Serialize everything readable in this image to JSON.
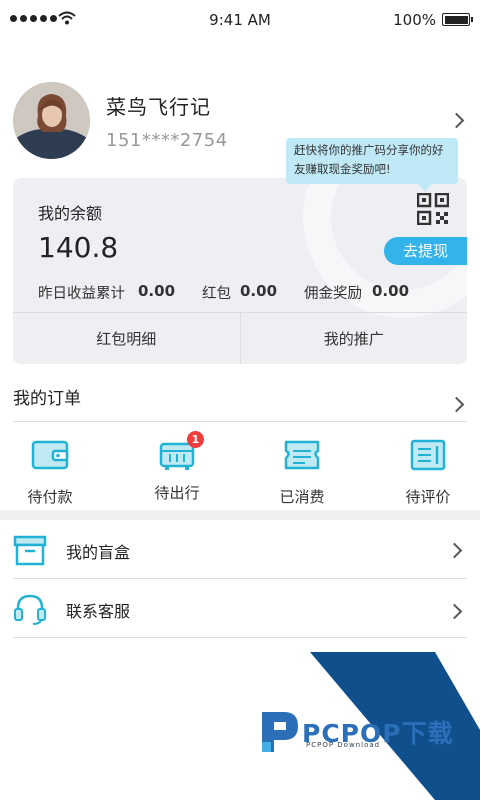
{
  "status_bar": {
    "time": "9:41 AM",
    "battery": "100%"
  },
  "profile": {
    "name": "菜鸟飞行记",
    "phone": "151****2754"
  },
  "promo_tooltip": "赶快将你的推广码分享你的好友赚取现金奖励吧!",
  "balance": {
    "title": "我的余额",
    "amount": "140.8",
    "withdraw_label": "去提现",
    "stats": [
      {
        "label": "昨日收益累计",
        "value": "0.00"
      },
      {
        "label": "红包",
        "value": "0.00"
      },
      {
        "label": "佣金奖励",
        "value": "0.00"
      }
    ],
    "links": [
      "红包明细",
      "我的推广"
    ]
  },
  "orders": {
    "title": "我的订单",
    "items": [
      {
        "label": "待付款",
        "icon": "wallet-icon"
      },
      {
        "label": "待出行",
        "icon": "bus-icon",
        "badge": "1"
      },
      {
        "label": "已消费",
        "icon": "ticket-icon"
      },
      {
        "label": "待评价",
        "icon": "review-icon"
      }
    ]
  },
  "menu": [
    {
      "label": "我的盲盒",
      "icon": "box-icon"
    },
    {
      "label": "联系客服",
      "icon": "headset-icon"
    }
  ],
  "watermark": {
    "text": "PCPOP下载",
    "sub": "PCPOP Download"
  },
  "colors": {
    "accent": "#32b3e9",
    "icon": "#22b2d6",
    "badge": "#f03e3e",
    "watermark_blue": "#0e4f8c"
  }
}
